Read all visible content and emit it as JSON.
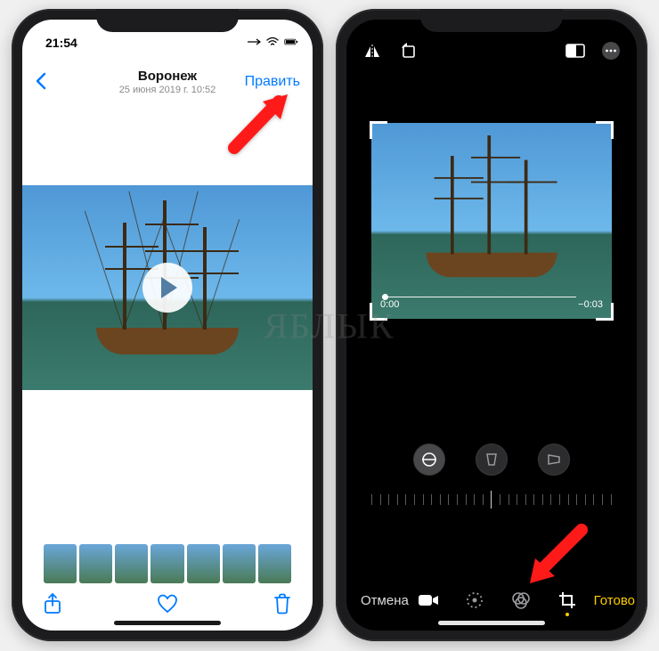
{
  "left": {
    "status": {
      "time": "21:54"
    },
    "nav": {
      "title": "Воронеж",
      "subtitle": "25 июня 2019 г. 10:52",
      "edit_label": "Править"
    }
  },
  "right": {
    "crop": {
      "time_current": "0:00",
      "time_remaining": "−0:03"
    },
    "toolbar": {
      "cancel_label": "Отмена",
      "done_label": "Готово"
    }
  },
  "watermark": "ЯБЛЫК",
  "colors": {
    "ios_blue": "#007aff",
    "ios_yellow": "#ffcc00",
    "ios_red": "#ff3b30"
  }
}
